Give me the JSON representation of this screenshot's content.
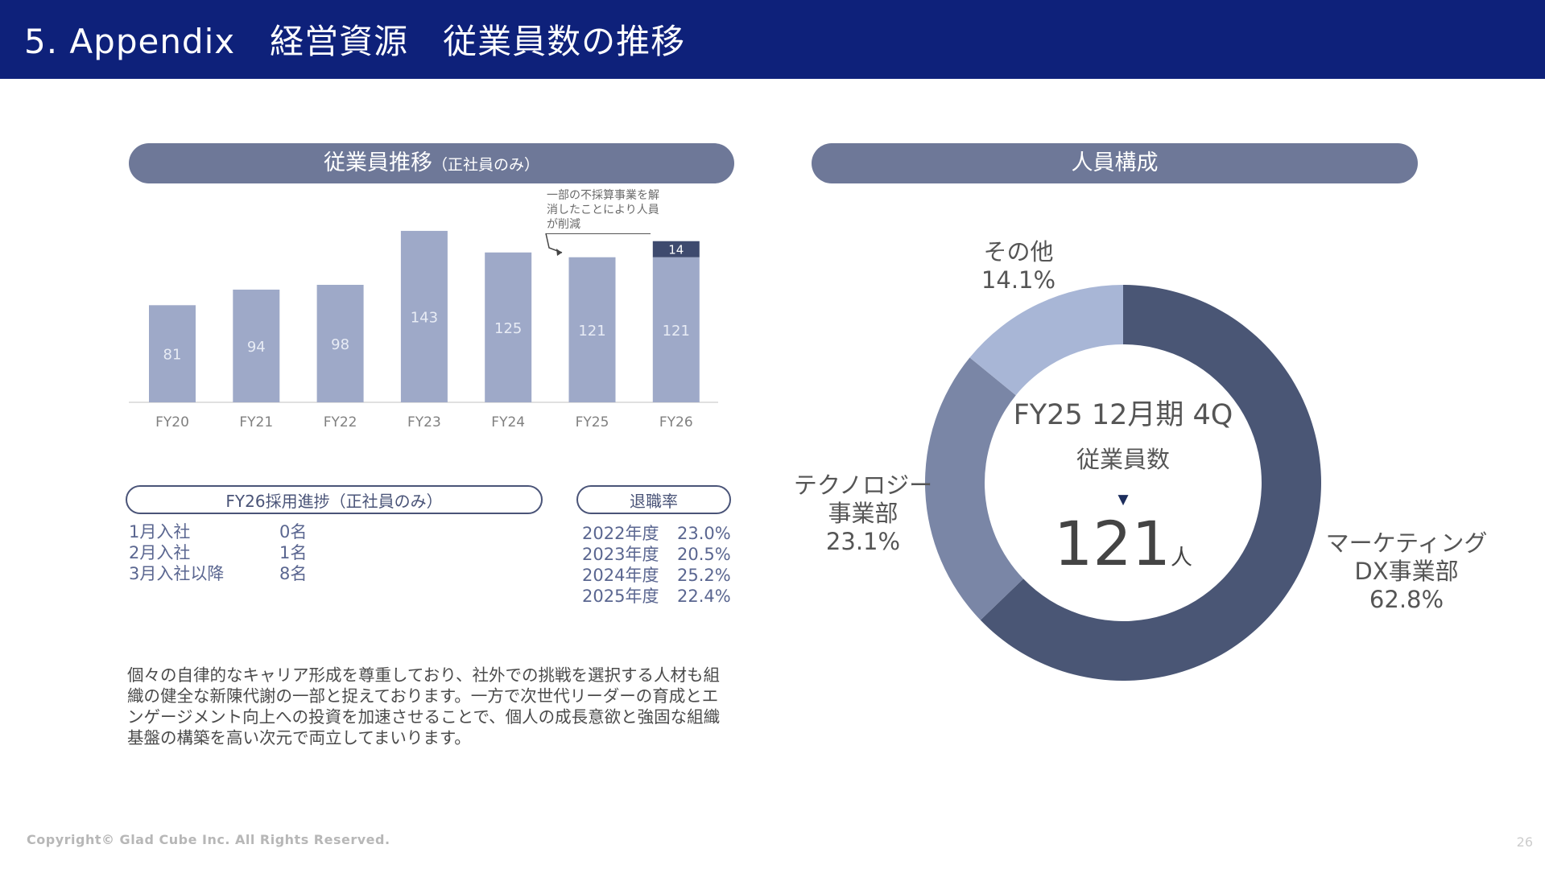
{
  "header": {
    "title": "5. Appendix　経営資源　従業員数の推移"
  },
  "bar_section": {
    "title": "従業員推移",
    "title_note": "（正社員のみ）",
    "annotation": "一部の不採算事業を解消したことにより人員が削減"
  },
  "pie_section": {
    "title": "人員構成"
  },
  "chart_data": [
    {
      "type": "bar",
      "categories": [
        "FY20",
        "FY21",
        "FY22",
        "FY23",
        "FY24",
        "FY25",
        "FY26"
      ],
      "series": [
        {
          "values": [
            81,
            94,
            98,
            143,
            125,
            121,
            121
          ]
        },
        {
          "values": [
            0,
            0,
            0,
            0,
            0,
            0,
            14
          ]
        }
      ],
      "data_labels": [
        "81",
        "94",
        "98",
        "143",
        "125",
        "121",
        "121"
      ],
      "stack_label": "14",
      "colors": {
        "base": "#9ea9c8",
        "increase": "#3e4a6e"
      },
      "title": "",
      "xlabel": "",
      "ylabel": ""
    },
    {
      "type": "pie",
      "labels": [
        "マーケティングDX事業部",
        "テクノロジー事業部",
        "その他"
      ],
      "values": [
        62.8,
        23.1,
        14.1
      ],
      "colors": [
        "#4a5675",
        "#7a86a6",
        "#a8b6d6"
      ],
      "center": {
        "line1": "FY25 12月期 4Q",
        "line2": "従業員数",
        "value": "121",
        "unit": "人"
      }
    }
  ],
  "pie_labels": {
    "marketing": {
      "line1": "マーケティング",
      "line2": "DX事業部",
      "pct": "62.8%"
    },
    "tech": {
      "line1": "テクノロジー",
      "line2": "事業部",
      "pct": "23.1%"
    },
    "other": {
      "line1": "その他",
      "pct": "14.1%"
    }
  },
  "hiring": {
    "title": "FY26採用進捗（正社員のみ）",
    "rows": [
      {
        "label": "1月入社",
        "value": "0名"
      },
      {
        "label": "2月入社",
        "value": "1名"
      },
      {
        "label": "3月入社以降",
        "value": "8名"
      }
    ]
  },
  "retirement": {
    "title": "退職率",
    "rows": [
      {
        "label": "2022年度",
        "value": "23.0%"
      },
      {
        "label": "2023年度",
        "value": "20.5%"
      },
      {
        "label": "2024年度",
        "value": "25.2%"
      },
      {
        "label": "2025年度",
        "value": "22.4%"
      }
    ]
  },
  "body_text": "個々の自律的なキャリア形成を尊重しており、社外での挑戦を選択する人材も組織の健全な新陳代謝の一部と捉えております。一方で次世代リーダーの育成とエンゲージメント向上への投資を加速させることで、個人の成長意欲と強固な組織基盤の構築を高い次元で両立してまいります。",
  "footer": {
    "copyright": "Copyright© Glad Cube Inc. All Rights Reserved.",
    "page": "26"
  }
}
